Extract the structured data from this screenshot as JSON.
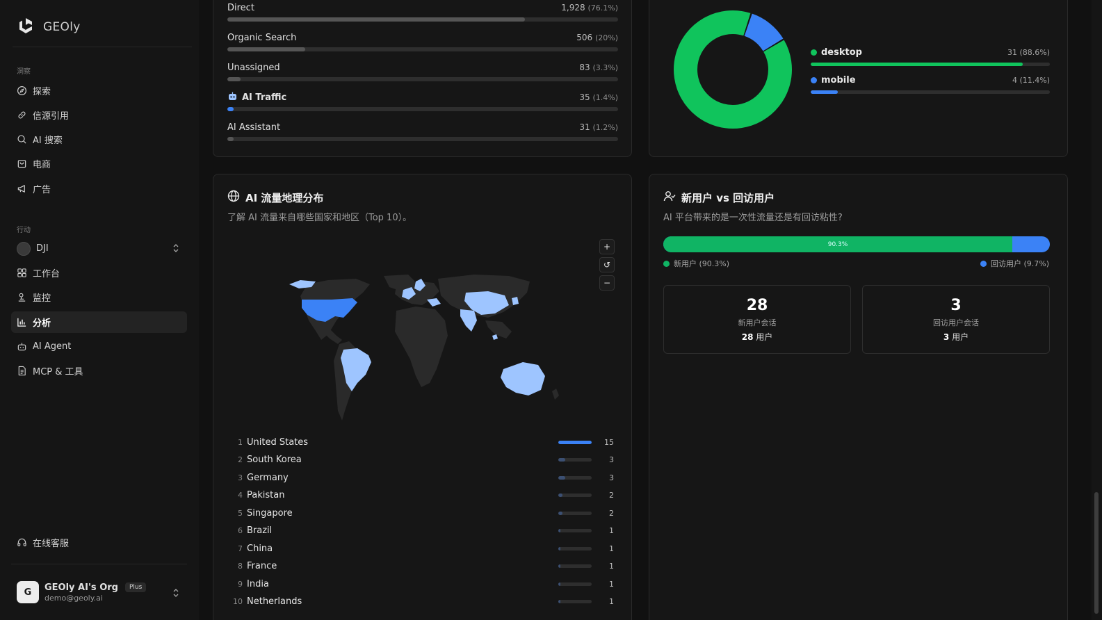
{
  "brand": {
    "name": "GEOly"
  },
  "sidebar": {
    "section_insight": "洞察",
    "section_action": "行动",
    "insight_items": [
      {
        "label": "探索",
        "icon": "compass-icon"
      },
      {
        "label": "信源引用",
        "icon": "link-icon"
      },
      {
        "label": "AI 搜索",
        "icon": "search-icon"
      },
      {
        "label": "电商",
        "icon": "shopping-bag-icon"
      },
      {
        "label": "广告",
        "icon": "megaphone-icon"
      }
    ],
    "project": {
      "label": "DJI"
    },
    "action_items": [
      {
        "label": "工作台",
        "icon": "grid-icon"
      },
      {
        "label": "监控",
        "icon": "monitor-icon"
      },
      {
        "label": "分析",
        "icon": "bar-chart-icon",
        "active": true
      },
      {
        "label": "AI Agent",
        "icon": "bot-icon"
      },
      {
        "label": "MCP & 工具",
        "icon": "file-icon"
      }
    ],
    "support": "在线客服",
    "user": {
      "initial": "G",
      "org": "GEOly AI's Org",
      "plan": "Plus",
      "email": "demo@geoly.ai"
    }
  },
  "traffic_sources": [
    {
      "name": "Direct",
      "value": "1,928",
      "pct": "(76.1%)",
      "share": 76.1,
      "highlight": false
    },
    {
      "name": "Organic Search",
      "value": "506",
      "pct": "(20%)",
      "share": 20,
      "highlight": false
    },
    {
      "name": "Unassigned",
      "value": "83",
      "pct": "(3.3%)",
      "share": 3.3,
      "highlight": false
    },
    {
      "name": "AI Traffic",
      "value": "35",
      "pct": "(1.4%)",
      "share": 1.4,
      "highlight": true
    },
    {
      "name": "AI Assistant",
      "value": "31",
      "pct": "(1.2%)",
      "share": 1.2,
      "highlight": false
    }
  ],
  "devices": {
    "items": [
      {
        "name": "desktop",
        "value": "31",
        "pct": "(88.6%)",
        "share": 88.6,
        "color": "#10c45c"
      },
      {
        "name": "mobile",
        "value": "4",
        "pct": "(11.4%)",
        "share": 11.4,
        "color": "#3b82f6"
      }
    ]
  },
  "geo": {
    "title": "AI 流量地理分布",
    "subtitle": "了解 AI 流量来自哪些国家和地区（Top 10）。",
    "zoom_in": "+",
    "reset": "↺",
    "zoom_out": "−",
    "countries": [
      {
        "rank": "1",
        "name": "United States",
        "value": 15
      },
      {
        "rank": "2",
        "name": "South Korea",
        "value": 3
      },
      {
        "rank": "3",
        "name": "Germany",
        "value": 3
      },
      {
        "rank": "4",
        "name": "Pakistan",
        "value": 2
      },
      {
        "rank": "5",
        "name": "Singapore",
        "value": 2
      },
      {
        "rank": "6",
        "name": "Brazil",
        "value": 1
      },
      {
        "rank": "7",
        "name": "China",
        "value": 1
      },
      {
        "rank": "8",
        "name": "France",
        "value": 1
      },
      {
        "rank": "9",
        "name": "India",
        "value": 1
      },
      {
        "rank": "10",
        "name": "Netherlands",
        "value": 1
      }
    ],
    "max": 15
  },
  "retention": {
    "title": "新用户 vs 回访用户",
    "subtitle": "AI 平台带来的是一次性流量还是有回访粘性?",
    "new_share": 90.3,
    "bar_label": "90.3%",
    "legend_new": "新用户 (90.3%)",
    "legend_return": "回访用户 (9.7%)",
    "new_sessions": "28",
    "new_sessions_label": "新用户会话",
    "new_users": "28",
    "return_sessions": "3",
    "return_sessions_label": "回访用户会话",
    "return_users": "3",
    "users_unit": "用户"
  },
  "colors": {
    "green": "#10c45c",
    "blue": "#3b82f6",
    "light_blue": "#9ec5ff",
    "land": "#2a2a2a"
  }
}
